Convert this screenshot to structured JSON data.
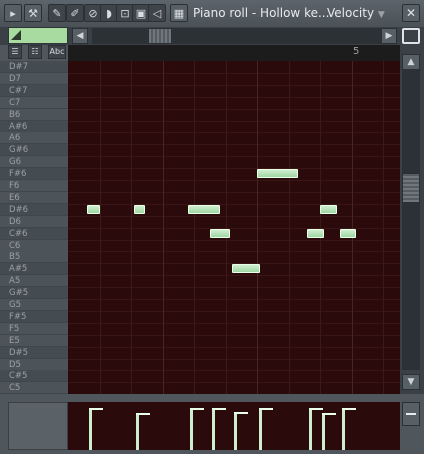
{
  "window": {
    "title": "Piano roll - Hollow ke...",
    "target_param": "Velocity",
    "close_label": "✕"
  },
  "toolbar": {
    "icons": [
      "arrow-icon",
      "wrench-icon",
      "pencil-icon",
      "paint-brush-icon",
      "delete-icon",
      "mute-icon",
      "slice-icon",
      "select-icon",
      "zoom-icon",
      "playback-icon",
      "snap-icon"
    ]
  },
  "ruler": {
    "bar_number": "5"
  },
  "keys": [
    "D#7",
    "D7",
    "C#7",
    "C7",
    "B6",
    "A#6",
    "A6",
    "G#6",
    "G6",
    "F#6",
    "F6",
    "E6",
    "D#6",
    "D6",
    "C#6",
    "C6",
    "B5",
    "A#5",
    "A5",
    "G#5",
    "G5",
    "F#5",
    "F5",
    "E5",
    "D#5",
    "D5",
    "C#5",
    "C5"
  ],
  "labels": {
    "abc": "Abc"
  },
  "notes": [
    {
      "pitch": "D#6",
      "start": 0.6,
      "length": 0.4
    },
    {
      "pitch": "D#6",
      "start": 2.1,
      "length": 0.35
    },
    {
      "pitch": "D#6",
      "start": 3.8,
      "length": 1.0
    },
    {
      "pitch": "C#6",
      "start": 4.5,
      "length": 0.65
    },
    {
      "pitch": "A#5",
      "start": 5.2,
      "length": 0.9
    },
    {
      "pitch": "F#6",
      "start": 6.0,
      "length": 1.3
    },
    {
      "pitch": "C#6",
      "start": 7.6,
      "length": 0.55
    },
    {
      "pitch": "D#6",
      "start": 8.0,
      "length": 0.55
    },
    {
      "pitch": "C#6",
      "start": 8.65,
      "length": 0.5
    }
  ],
  "velocity_lanes": [
    {
      "pos": 0.6,
      "level": 0.88
    },
    {
      "pos": 2.1,
      "level": 0.78
    },
    {
      "pos": 3.8,
      "level": 0.88
    },
    {
      "pos": 4.5,
      "level": 0.88
    },
    {
      "pos": 5.2,
      "level": 0.8
    },
    {
      "pos": 6.0,
      "level": 0.88
    },
    {
      "pos": 7.6,
      "level": 0.88
    },
    {
      "pos": 8.0,
      "level": 0.78
    },
    {
      "pos": 8.65,
      "level": 0.88
    }
  ]
}
